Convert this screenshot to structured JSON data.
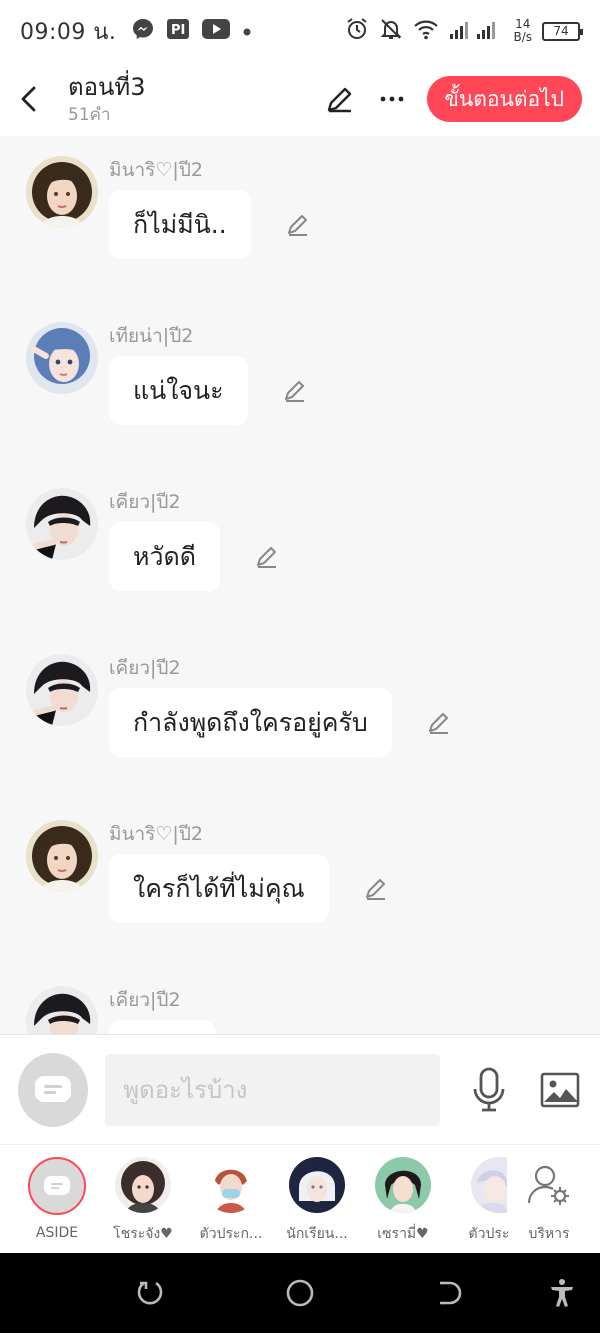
{
  "status_bar": {
    "time": "09:09 น.",
    "net_speed_value": "14",
    "net_speed_unit": "B/s",
    "battery": "74",
    "icons": [
      "messenger-icon",
      "pandora-icon",
      "youtube-icon",
      "dot-icon",
      "alarm-icon",
      "mute-icon",
      "wifi-icon",
      "signal-icon"
    ]
  },
  "header": {
    "title": "ตอนที่3",
    "word_count": "51คำ",
    "next_label": "ขั้นตอนต่อไป",
    "accent_color": "#ff4757"
  },
  "messages": [
    {
      "sender": "มินาริ♡|ปี2",
      "text": "ก็ไม่มีนิ..",
      "avatar": "girl-brown-hair"
    },
    {
      "sender": "เทียน่า|ปี2",
      "text": "แน่ใจนะ",
      "avatar": "girl-blue-hair"
    },
    {
      "sender": "เคียว|ปี2",
      "text": "หวัดดี",
      "avatar": "boy-dark-hair"
    },
    {
      "sender": "เคียว|ปี2",
      "text": "กำลังพูดถึงใครอยู่ครับ",
      "avatar": "boy-dark-hair"
    },
    {
      "sender": "มินาริ♡|ปี2",
      "text": "ใครก็ได้ที่ไม่คุณ",
      "avatar": "girl-brown-hair"
    },
    {
      "sender": "เคียว|ปี2",
      "text": "",
      "avatar": "boy-dark-hair"
    }
  ],
  "input": {
    "placeholder": "พูดอะไรบ้าง"
  },
  "characters": [
    {
      "label": "ASIDE"
    },
    {
      "label": "โชระจัง♥"
    },
    {
      "label": "ตัวประก..."
    },
    {
      "label": "นักเรียน..."
    },
    {
      "label": "เซรามี่♥"
    },
    {
      "label": "ตัวประ"
    },
    {
      "label": "บริหาร"
    }
  ]
}
